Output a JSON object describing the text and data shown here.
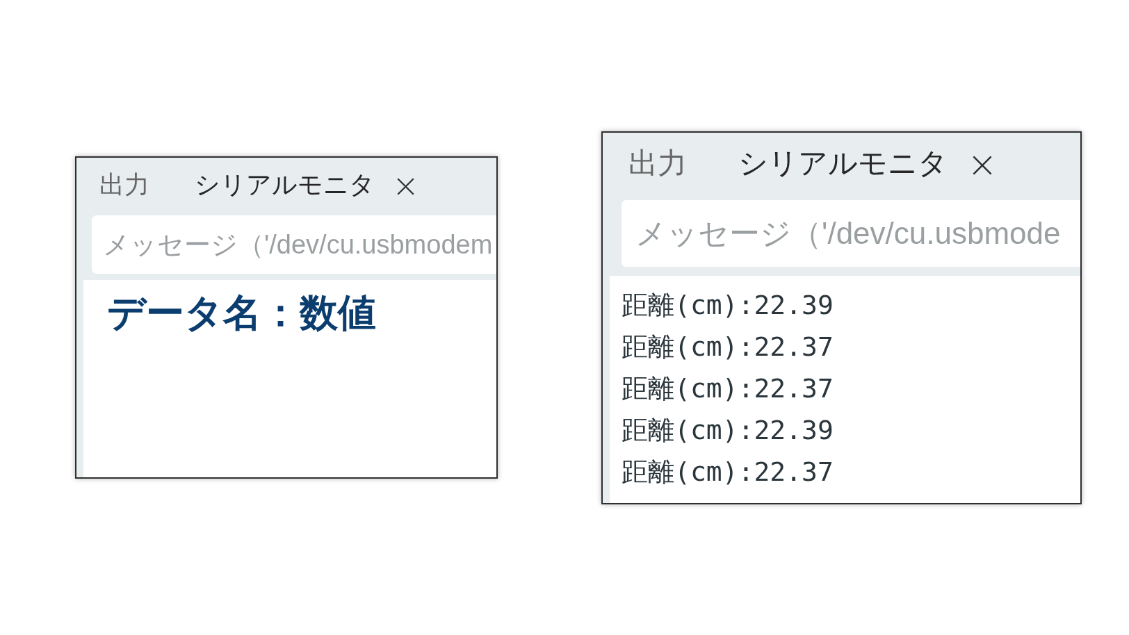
{
  "panels": [
    {
      "tabs": [
        {
          "label": "出力",
          "selected": false,
          "closable": false
        },
        {
          "label": "シリアルモニタ",
          "selected": true,
          "closable": true
        }
      ],
      "message_field": {
        "placeholder": "メッセージ（'/dev/cu.usbmodem"
      },
      "output": {
        "kind": "caption",
        "lines": [
          "データ名：数値"
        ]
      }
    },
    {
      "tabs": [
        {
          "label": "出力",
          "selected": false,
          "closable": false
        },
        {
          "label": "シリアルモニタ",
          "selected": true,
          "closable": true
        }
      ],
      "message_field": {
        "placeholder": "メッセージ（'/dev/cu.usbmode"
      },
      "output": {
        "kind": "log",
        "lines": [
          "距離(cm):22.39",
          "距離(cm):22.37",
          "距離(cm):22.37",
          "距離(cm):22.39",
          "距離(cm):22.37"
        ]
      }
    }
  ]
}
